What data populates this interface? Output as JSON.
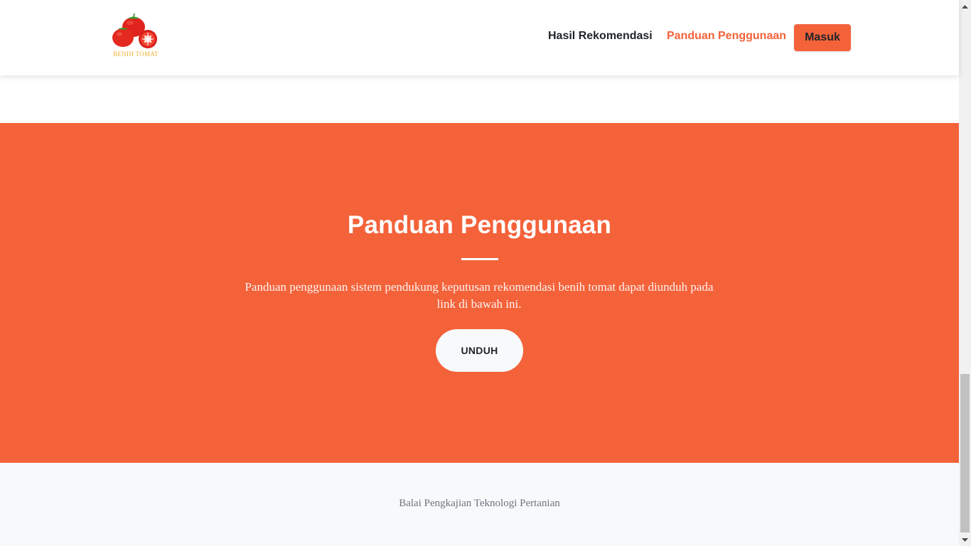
{
  "navbar": {
    "brand_text": "BENIH TOMAT",
    "links": [
      {
        "label": "Hasil Rekomendasi"
      },
      {
        "label": "Panduan Penggunaan"
      }
    ],
    "login_label": "Masuk",
    "accent_color": "#f4623a"
  },
  "guide": {
    "title": "Panduan Penggunaan",
    "description": "Panduan penggunaan sistem pendukung keputusan rekomendasi benih tomat dapat diunduh pada link di bawah ini.",
    "download_label": "UNDUH",
    "background_color": "#f4623a"
  },
  "footer": {
    "text": "Balai Pengkajian Teknologi Pertanian"
  },
  "icons": {
    "logo": "tomato-logo-icon",
    "scroll_up": "chevron-up-icon",
    "scroll_down": "chevron-down-icon"
  }
}
